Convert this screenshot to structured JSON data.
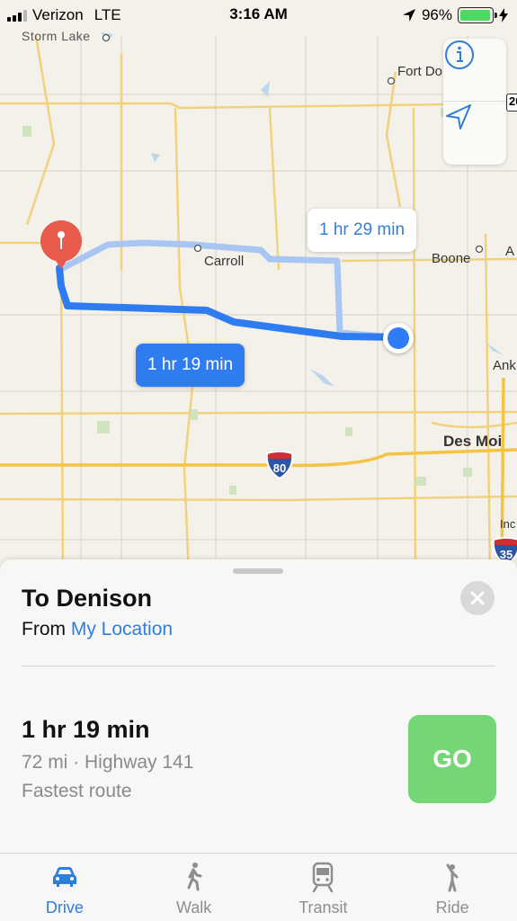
{
  "status_bar": {
    "carrier": "Verizon",
    "network": "LTE",
    "time": "3:16 AM",
    "battery_percent": "96%",
    "battery_level": 0.96
  },
  "map": {
    "place_labels": {
      "storm_lake": "Storm Lake",
      "fort_dodge": "Fort Do",
      "carroll": "Carroll",
      "boone": "Boone",
      "ames_partial": "A",
      "ankeny_partial": "Ank",
      "des_moines": "Des Moi",
      "indianola_partial": "Inc"
    },
    "highway_shields": {
      "i80": "80",
      "i35": "35",
      "us20_partial": "20"
    },
    "route_callouts": {
      "alternate": "1 hr 29 min",
      "selected": "1 hr 19 min"
    },
    "colors": {
      "selected_route": "#2e7cf0",
      "alternate_route": "#a9c5f2",
      "destination_pin": "#e85a4b",
      "user_location": "#2f7cf6"
    }
  },
  "sheet": {
    "destination": "To Denison",
    "from_prefix": "From",
    "from_location": "My Location",
    "route": {
      "duration": "1 hr 19 min",
      "details": "72 mi · Highway 141",
      "note": "Fastest route"
    },
    "go_label": "GO",
    "go_color": "#74d676"
  },
  "tabbar": {
    "tabs": [
      {
        "label": "Drive",
        "icon": "car-icon",
        "active": true
      },
      {
        "label": "Walk",
        "icon": "walking-person-icon",
        "active": false
      },
      {
        "label": "Transit",
        "icon": "train-icon",
        "active": false
      },
      {
        "label": "Ride",
        "icon": "hailing-person-icon",
        "active": false
      }
    ]
  }
}
